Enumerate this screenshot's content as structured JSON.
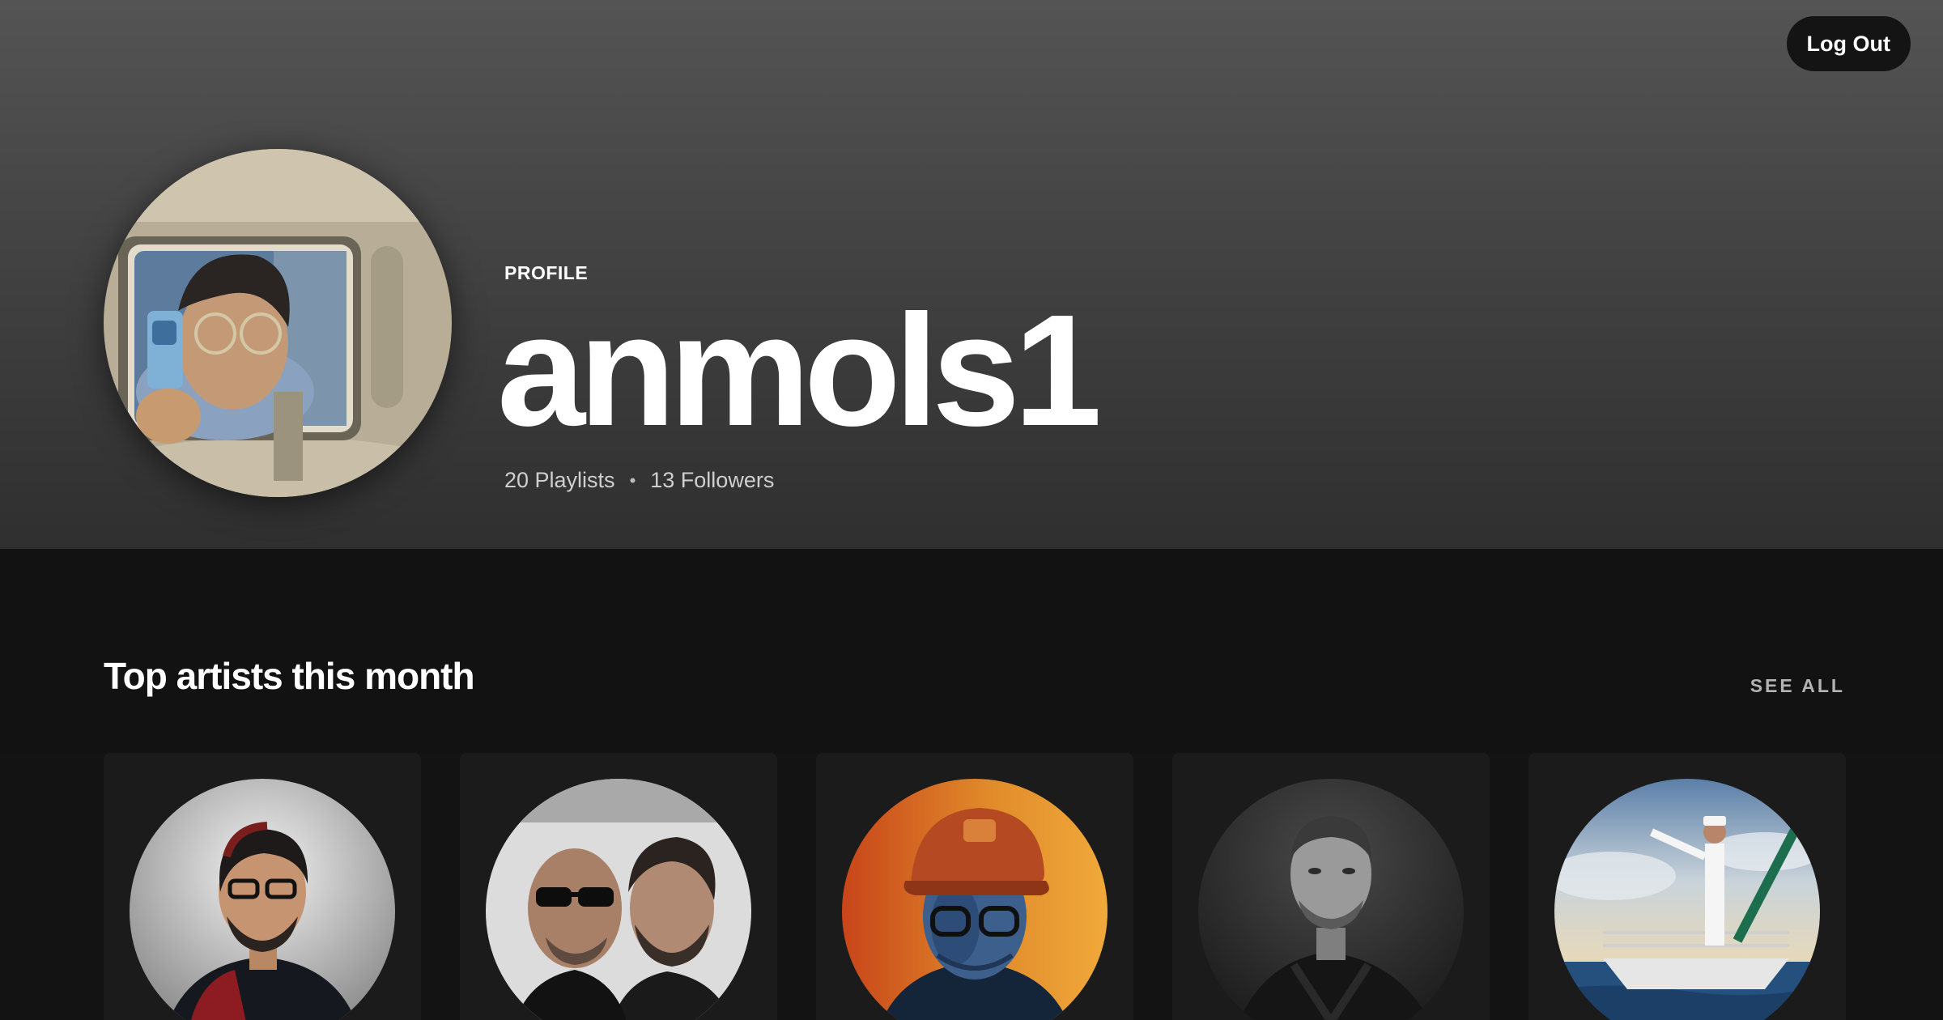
{
  "header": {
    "logout_label": "Log Out",
    "profile_label": "PROFILE",
    "username": "anmols1",
    "playlists_text": "20 Playlists",
    "separator": "•",
    "followers_text": "13 Followers"
  },
  "top_artists": {
    "title": "Top artists this month",
    "see_all_label": "SEE ALL"
  },
  "colors": {
    "header_gradient_top": "#545454",
    "header_gradient_bottom": "#2f2f2f",
    "page_background": "#121212",
    "card_background": "#1b1b1b",
    "button_background": "#141414"
  }
}
